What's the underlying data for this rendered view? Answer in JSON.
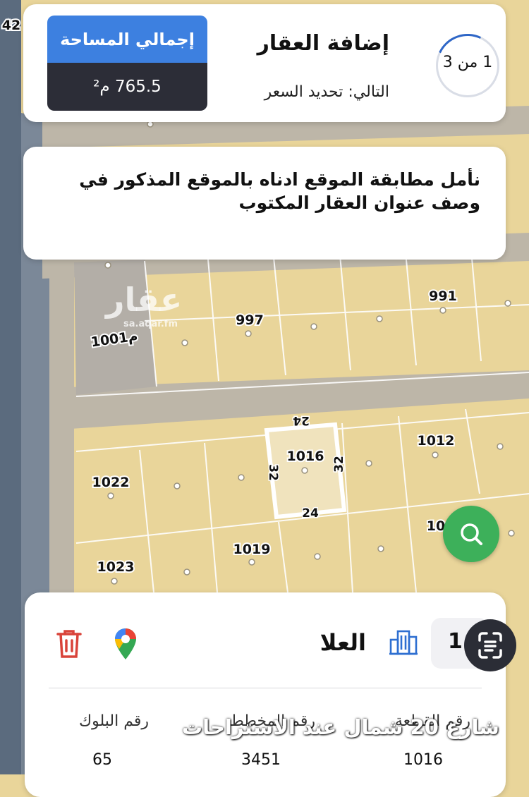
{
  "header": {
    "progress": "1 من 3",
    "title": "إضافة العقار",
    "next": "التالي: تحديد السعر",
    "area_label": "إجمالي المساحة",
    "area_value": "765.5 م²"
  },
  "note": {
    "text": "نأمل مطابقة الموقع ادناه بالموقع المذكور في وصف عنوان العقار المكتوب"
  },
  "map": {
    "corner_number": "42",
    "parcels": {
      "p991": "991",
      "p997": "997",
      "p1001": "1001م",
      "p1012": "1012",
      "p1016": "1016",
      "p1022": "1022",
      "p1019": "1019",
      "p1023": "1023",
      "p10xx": "10"
    },
    "dimensions": {
      "top": "24",
      "bottom": "24",
      "left": "32",
      "right": "32"
    },
    "watermark": "عقار",
    "watermark_url": "sa.aqar.fm"
  },
  "bottom": {
    "count": "1",
    "city": "العلا",
    "labels": {
      "block": "رقم البلوك",
      "plan": "رقم المخطط",
      "plot": "رقم القطعة"
    },
    "values": {
      "block": "65",
      "plan": "3451",
      "plot": "1016"
    }
  },
  "caption": "شارع 20 شمال عند الاستراحات",
  "colors": {
    "map_parcel": "#e9d59a",
    "map_street": "#bdb6a8",
    "map_grey_lot": "#b3aea7",
    "area_label_bg": "#3d80e0",
    "area_value_bg": "#2c2d37",
    "fab_green": "#3db05a",
    "trash_red": "#d9433a"
  }
}
